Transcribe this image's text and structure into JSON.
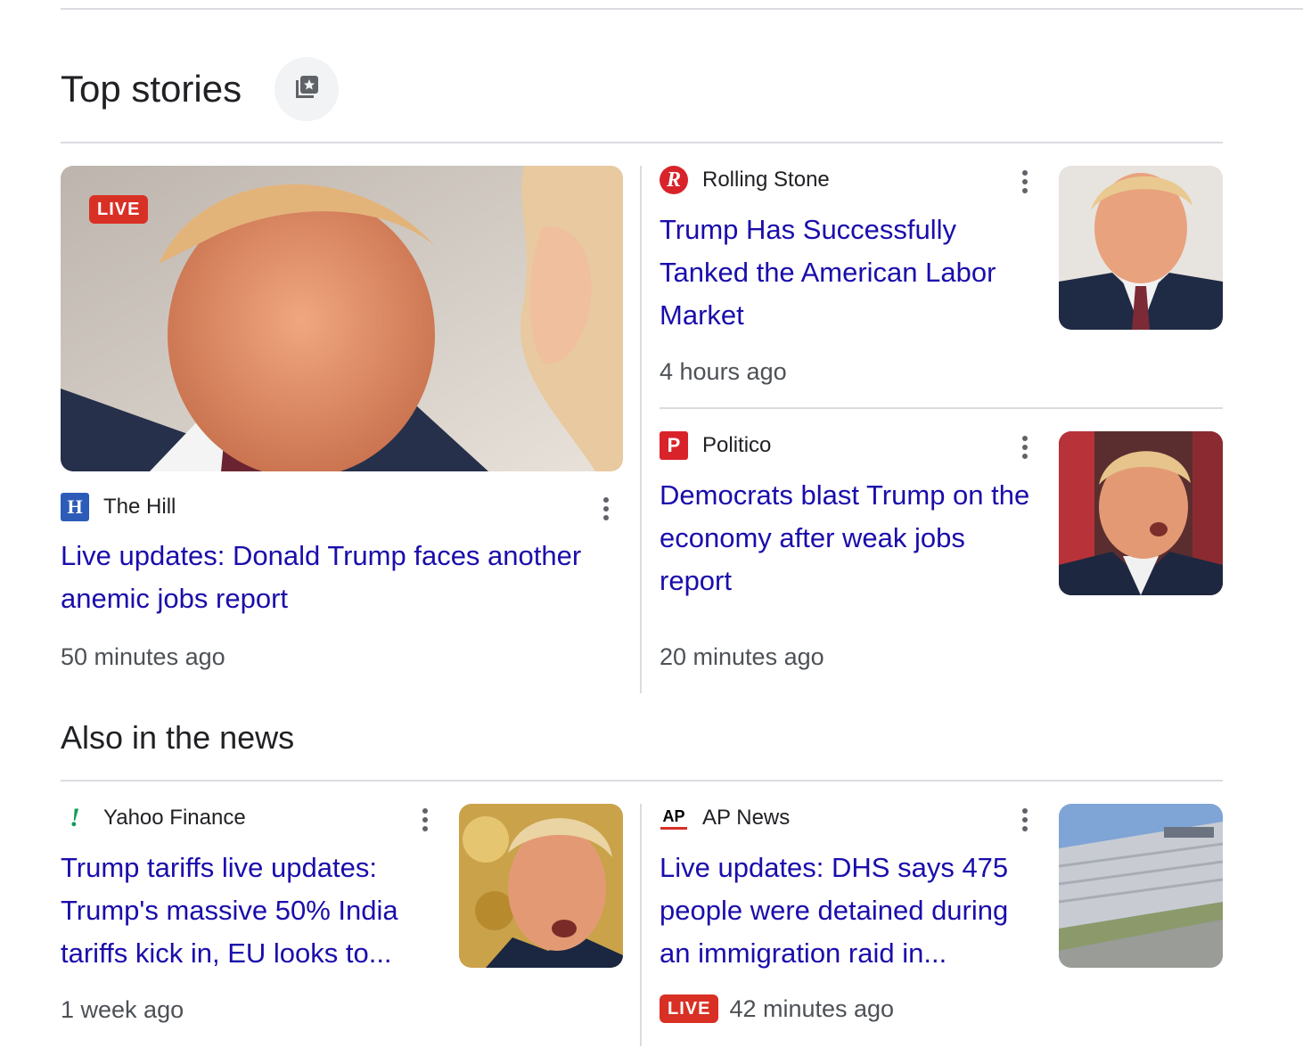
{
  "top_stories": {
    "title": "Top stories",
    "icon": "library-star-icon"
  },
  "featured": {
    "live_label": "LIVE",
    "source": "The Hill",
    "source_logo": "H",
    "headline": "Live updates: Donald Trump faces another anemic jobs report",
    "time": "50 minutes ago"
  },
  "side_stories": [
    {
      "source": "Rolling Stone",
      "source_logo": "R",
      "headline": "Trump Has Successfully Tanked the American Labor Market",
      "time": "4 hours ago"
    },
    {
      "source": "Politico",
      "source_logo": "P",
      "headline": "Democrats blast Trump on the economy after weak jobs report",
      "time": "20 minutes ago"
    }
  ],
  "also_in_news": {
    "title": "Also in the news",
    "items": [
      {
        "source": "Yahoo Finance",
        "source_logo": "!",
        "headline": "Trump tariffs live updates: Trump's massive 50% India tariffs kick in, EU looks to...",
        "time": "1 week ago"
      },
      {
        "source": "AP News",
        "source_logo": "AP",
        "headline": "Live updates: DHS says 475 people were detained during an immigration raid in...",
        "live_label": "LIVE",
        "time": "42 minutes ago"
      }
    ]
  },
  "colors": {
    "link": "#1a0dab",
    "live": "#d93025",
    "divider": "#dadce0"
  }
}
